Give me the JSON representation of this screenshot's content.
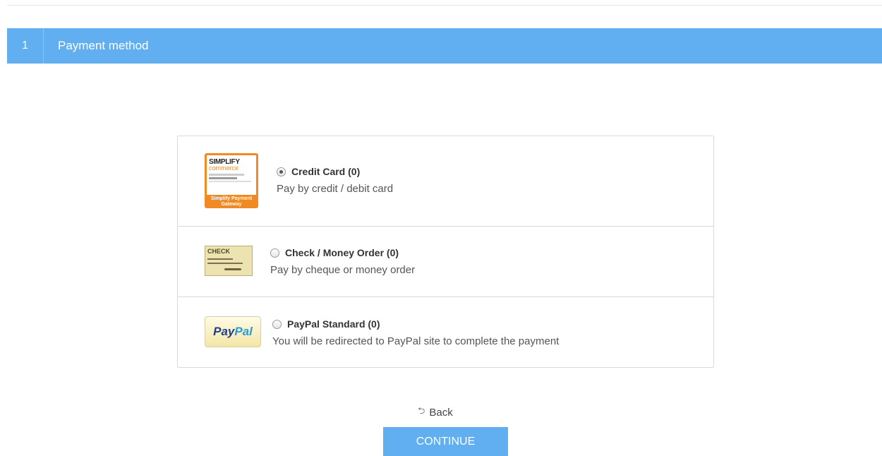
{
  "step": {
    "number": "1",
    "title": "Payment method"
  },
  "methods": [
    {
      "name": "Credit Card (0)",
      "description": "Pay by credit / debit card",
      "selected": true,
      "logo": "simplify-commerce-logo",
      "logo_text": {
        "line1": "SIMPLIFY",
        "line2": "commerce",
        "footer": "Simplify Payment Gateway"
      }
    },
    {
      "name": "Check / Money Order (0)",
      "description": "Pay by cheque or money order",
      "selected": false,
      "logo": "check-logo",
      "logo_text": {
        "line1": "CHECK"
      }
    },
    {
      "name": "PayPal Standard (0)",
      "description": "You will be redirected to PayPal site to complete the payment",
      "selected": false,
      "logo": "paypal-logo",
      "logo_text": {
        "pay": "Pay",
        "pal": "Pal"
      }
    }
  ],
  "actions": {
    "back_icon": "⮌",
    "back_label": "Back",
    "continue_label": "CONTINUE"
  },
  "colors": {
    "accent": "#61aff0",
    "border": "#d9d9d9"
  }
}
